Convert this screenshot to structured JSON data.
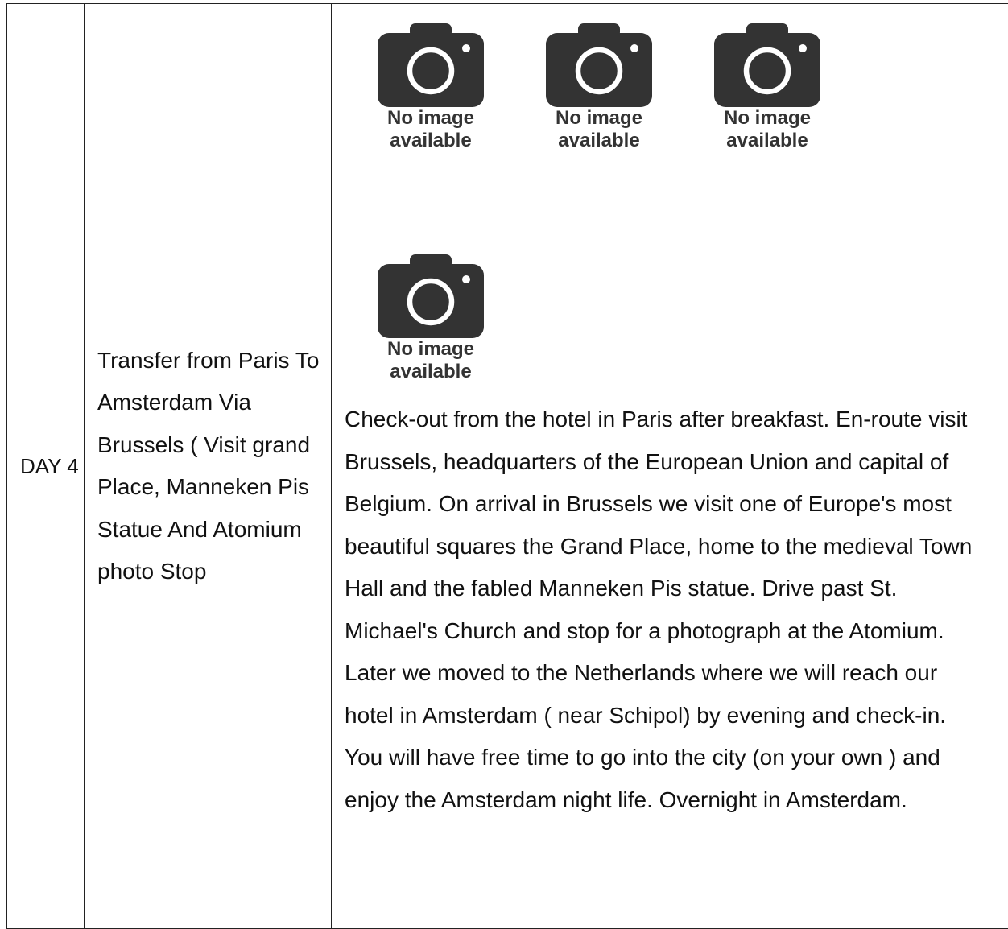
{
  "itinerary": {
    "day_label": "DAY 4",
    "title": "Transfer from Paris To Amsterdam Via Brussels ( Visit grand Place, Manneken Pis Statue And Atomium photo Stop",
    "placeholder_text_line1": "No image",
    "placeholder_text_line2": "available",
    "description": "Check-out from the hotel in Paris after breakfast. En-route visit Brussels, headquarters of the European Union and capital of Belgium. On arrival in Brussels we visit one of Europe's most beautiful squares the Grand Place, home to the medieval Town Hall and the fabled Manneken Pis statue. Drive past St. Michael's Church and stop for a photograph at the Atomium. Later we moved to the Netherlands where we will reach our hotel in Amsterdam ( near Schipol) by evening and check-in. You will have free time to go into the city (on your own ) and enjoy the Amsterdam night life. Overnight in Amsterdam."
  },
  "icons": {
    "placeholder": "camera-icon",
    "color": "#333333"
  }
}
